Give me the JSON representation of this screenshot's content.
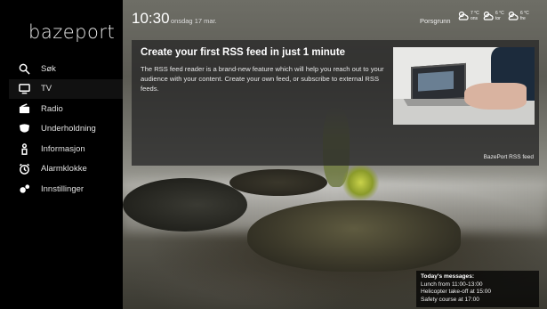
{
  "app": {
    "logo": "bazeport"
  },
  "sidebar": {
    "items": [
      {
        "label": "Søk",
        "icon": "search-icon"
      },
      {
        "label": "TV",
        "icon": "tv-icon",
        "active": true
      },
      {
        "label": "Radio",
        "icon": "radio-icon"
      },
      {
        "label": "Underholdning",
        "icon": "entertainment-icon"
      },
      {
        "label": "Informasjon",
        "icon": "info-icon"
      },
      {
        "label": "Alarmklokke",
        "icon": "alarm-clock-icon"
      },
      {
        "label": "Innstillinger",
        "icon": "settings-icon"
      }
    ]
  },
  "topbar": {
    "time": "10:30",
    "date": "onsdag 17 mar.",
    "location": "Porsgrunn",
    "weather": [
      {
        "temp": "7 °C",
        "day": "ons",
        "icon": "cloud-sun-icon"
      },
      {
        "temp": "6 °C",
        "day": "tor",
        "icon": "cloud-sun-icon"
      },
      {
        "temp": "6 °C",
        "day": "fre",
        "icon": "cloud-sun-icon"
      }
    ]
  },
  "banner": {
    "title": "Create your first RSS feed in just 1 minute",
    "body": "The RSS feed reader is a brand-new feature which will help you reach out to your audience with your content. Create your own feed, or subscribe to external RSS feeds.",
    "caption": "BazePort RSS feed"
  },
  "messages": {
    "title": "Today's messages:",
    "lines": [
      "Lunch from 11:00-13:00",
      "Helicopter take-off at 15:00",
      "Safety course at 17:00"
    ]
  },
  "colors": {
    "background": "#000000",
    "active_indicator": "#ffffff",
    "banner_bg": "#282828"
  }
}
